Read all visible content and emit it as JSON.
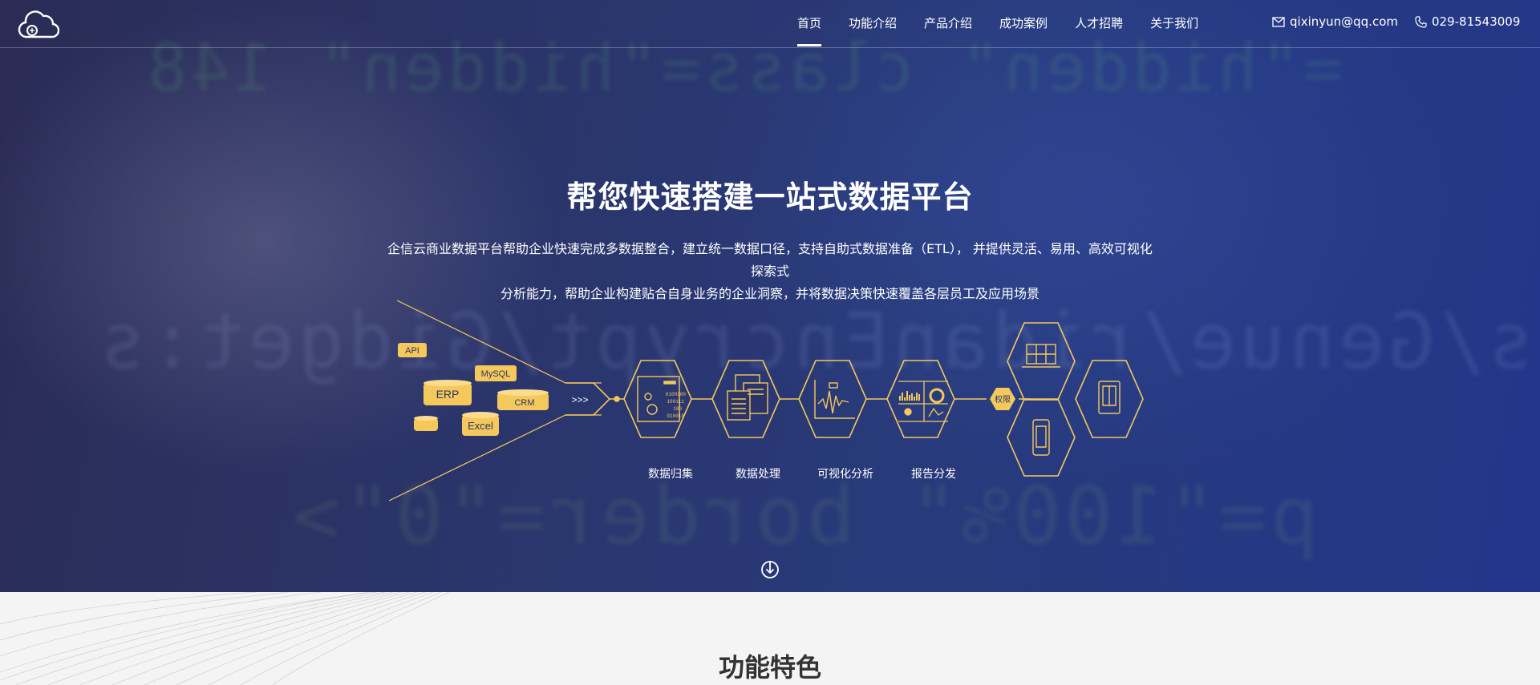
{
  "nav": {
    "items": [
      {
        "label": "首页",
        "active": true
      },
      {
        "label": "功能介绍",
        "active": false
      },
      {
        "label": "产品介绍",
        "active": false
      },
      {
        "label": "成功案例",
        "active": false
      },
      {
        "label": "人才招聘",
        "active": false
      },
      {
        "label": "关于我们",
        "active": false
      }
    ],
    "email": "qixinyun@qq.com",
    "phone": "029-81543009"
  },
  "hero": {
    "title": "帮您快速搭建一站式数据平台",
    "desc_line1": "企信云商业数据平台帮助企业快速完成多数据整合，建立统一数据口径，支持自助式数据准备（ETL）， 并提供灵活、易用、高效可视化探索式",
    "desc_line2": "分析能力，帮助企业构建贴合自身业务的企业洞察，并将数据决策快速覆盖各层员工及应用场景",
    "background_code": {
      "line1": "=\"hidden\" class=\"hidden\" 148",
      "line2": "s/Genue/ridanEncrypt/Gidget:s",
      "line3": "p=\"100%\" border=\"0\">"
    }
  },
  "diagram": {
    "sources": [
      "API",
      "MySQL",
      "ERP",
      "CRM",
      "Excel"
    ],
    "arrow": ">>>",
    "binary": [
      "0100100",
      "100111",
      "100",
      "010010"
    ],
    "stages": [
      "数据归集",
      "数据处理",
      "可视化分析",
      "报告分发"
    ],
    "permission": "权限",
    "accent": "#f5c85c"
  },
  "features": {
    "title": "功能特色"
  },
  "colors": {
    "hero_bg": "#283a7a",
    "accent": "#f5c85c",
    "section_bg": "#f4f4f4"
  }
}
